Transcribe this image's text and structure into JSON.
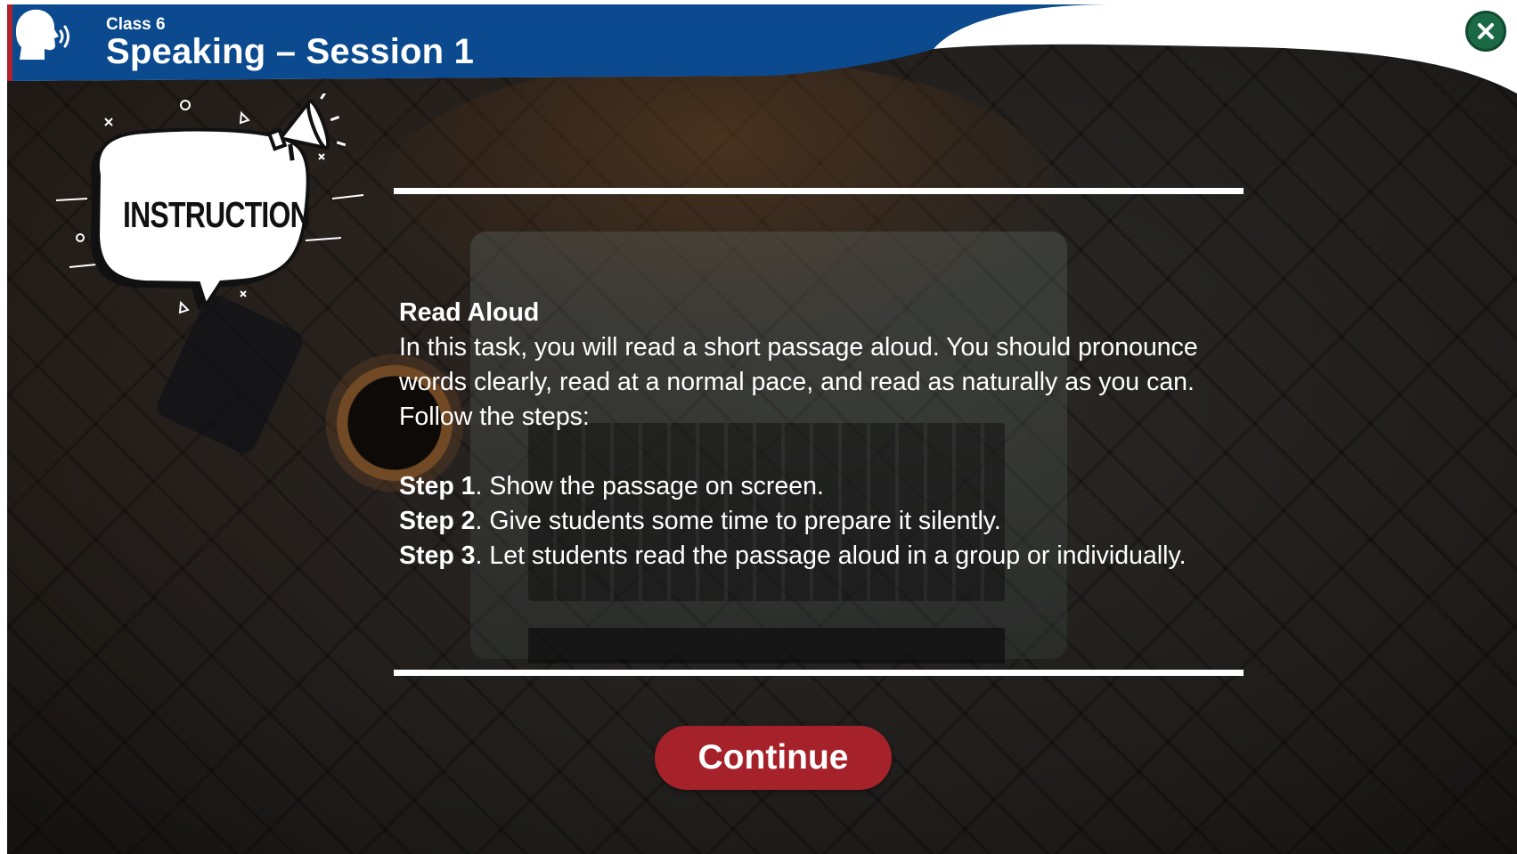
{
  "header": {
    "class_label": "Class 6",
    "title": "Speaking – Session 1"
  },
  "badge": {
    "label": "INSTRUCTION"
  },
  "content": {
    "heading": "Read Aloud",
    "intro": "In this task, you will read a short passage aloud. You should pronounce words clearly, read at a normal pace, and read as naturally as you can. Follow the steps:",
    "steps": [
      {
        "label": "Step 1",
        "text": ". Show the passage on screen."
      },
      {
        "label": "Step 2",
        "text": ". Give students some time to prepare it silently."
      },
      {
        "label": "Step 3",
        "text": ". Let students read the passage aloud in a group or individually."
      }
    ]
  },
  "actions": {
    "continue_label": "Continue",
    "close_icon": "close-icon"
  },
  "colors": {
    "header_blue": "#0b4a8f",
    "accent_red": "#a6222a",
    "close_green": "#1b6a45"
  }
}
